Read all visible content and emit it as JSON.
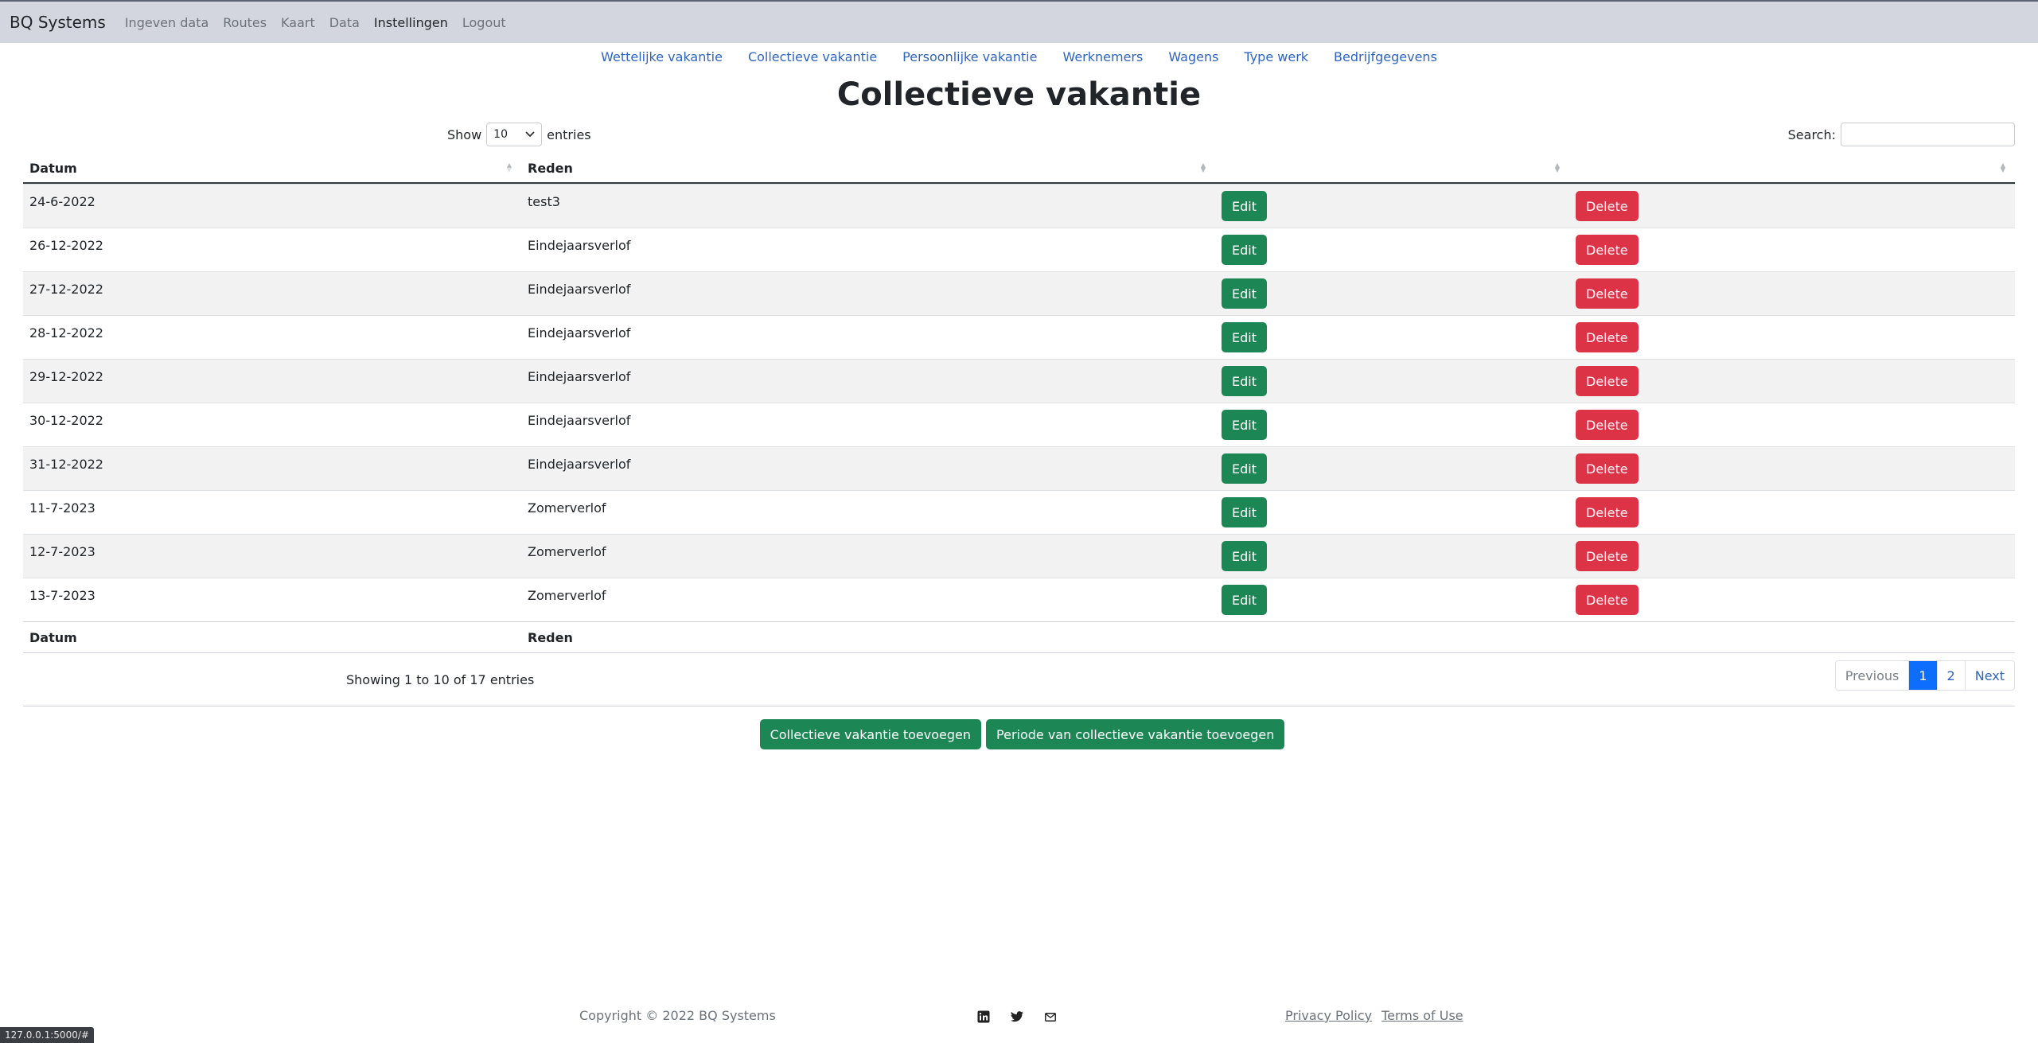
{
  "navbar": {
    "brand": "BQ Systems",
    "links": [
      "Ingeven data",
      "Routes",
      "Kaart",
      "Data",
      "Instellingen",
      "Logout"
    ]
  },
  "subnav": [
    "Wettelijke vakantie",
    "Collectieve vakantie",
    "Persoonlijke vakantie",
    "Werknemers",
    "Wagens",
    "Type werk",
    "Bedrijfgegevens"
  ],
  "page_title": "Collectieve vakantie",
  "controls": {
    "show_label": "Show",
    "entries_value": "10",
    "entries_label": "entries",
    "search_label": "Search:"
  },
  "table": {
    "headers": [
      "Datum",
      "Reden"
    ],
    "rows": [
      {
        "date": "24-6-2022",
        "reason": "test3"
      },
      {
        "date": "26-12-2022",
        "reason": "Eindejaarsverlof"
      },
      {
        "date": "27-12-2022",
        "reason": "Eindejaarsverlof"
      },
      {
        "date": "28-12-2022",
        "reason": "Eindejaarsverlof"
      },
      {
        "date": "29-12-2022",
        "reason": "Eindejaarsverlof"
      },
      {
        "date": "30-12-2022",
        "reason": "Eindejaarsverlof"
      },
      {
        "date": "31-12-2022",
        "reason": "Eindejaarsverlof"
      },
      {
        "date": "11-7-2023",
        "reason": "Zomerverlof"
      },
      {
        "date": "12-7-2023",
        "reason": "Zomerverlof"
      },
      {
        "date": "13-7-2023",
        "reason": "Zomerverlof"
      }
    ],
    "edit_label": "Edit",
    "delete_label": "Delete",
    "info": "Showing 1 to 10 of 17 entries"
  },
  "pagination": {
    "previous": "Previous",
    "pages": [
      "1",
      "2"
    ],
    "next": "Next"
  },
  "actions": {
    "add": "Collectieve vakantie toevoegen",
    "add_period": "Periode van collectieve vakantie toevoegen"
  },
  "footer": {
    "copyright": "Copyright © 2022 BQ Systems",
    "social_icons": [
      "linkedin-icon",
      "twitter-icon",
      "mail-icon"
    ],
    "privacy": "Privacy Policy",
    "terms": "Terms of Use"
  },
  "status_url": "127.0.0.1:5000/#",
  "colors": {
    "edit": "#1c8755",
    "delete": "#dc3347",
    "active_page": "#0d6efd",
    "link": "#2e64c2"
  }
}
